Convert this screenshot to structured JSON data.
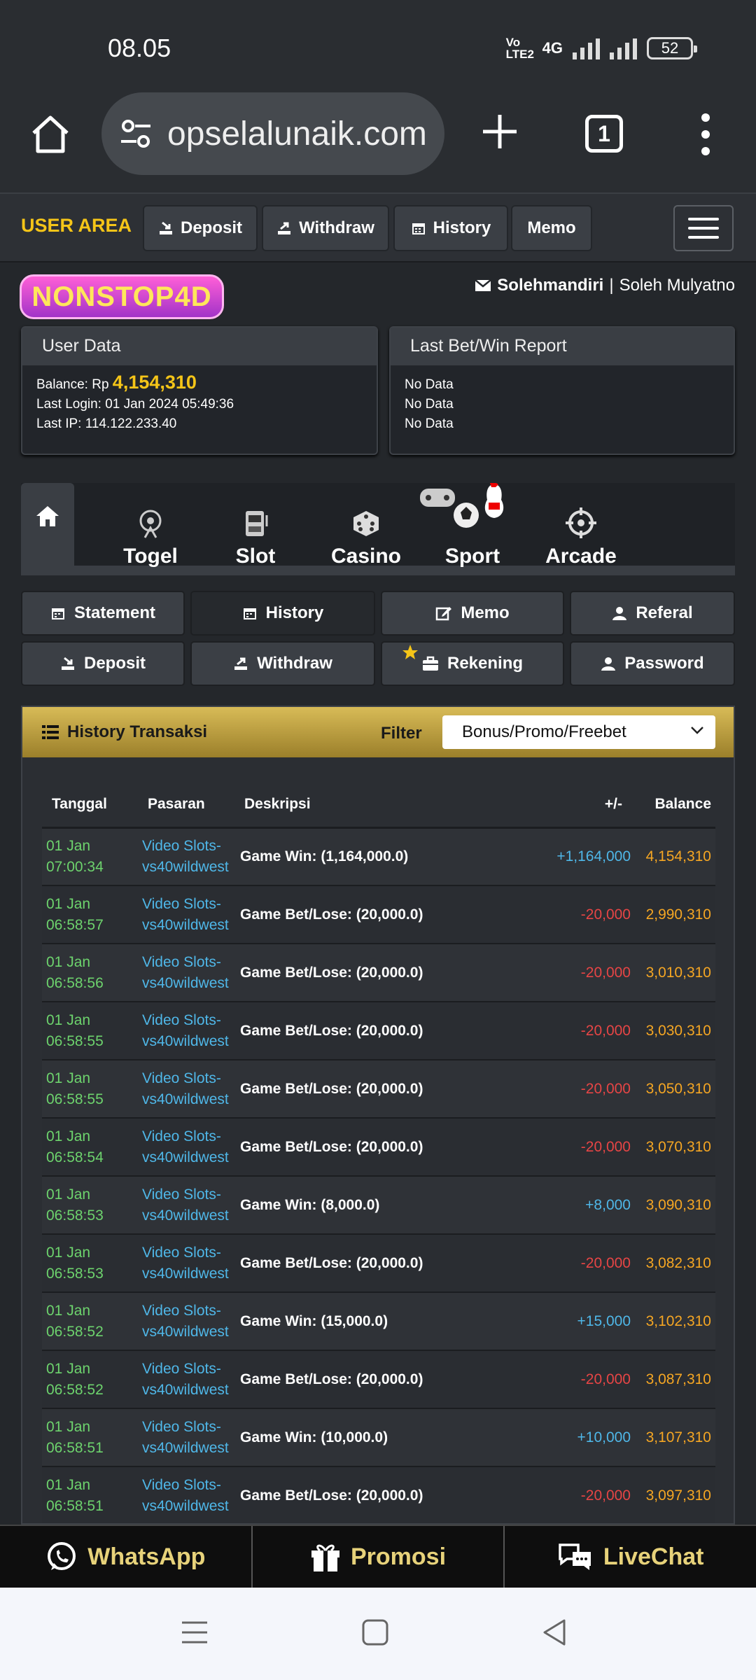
{
  "status": {
    "time": "08.05",
    "volte": "Vo LTE2",
    "net": "4G",
    "battery": "52"
  },
  "browser": {
    "url": "opselalunaik.com",
    "tab_count": "1"
  },
  "topnav": {
    "user_area": "USER AREA",
    "deposit": "Deposit",
    "withdraw": "Withdraw",
    "history": "History",
    "memo": "Memo"
  },
  "brand": {
    "logo_text": "NONSTOP4D"
  },
  "user": {
    "username": "Solehmandiri",
    "separator": "|",
    "fullname": "Soleh Mulyatno"
  },
  "user_data": {
    "title": "User Data",
    "balance_label": "Balance: Rp",
    "balance": "4,154,310",
    "last_login": "Last Login: 01 Jan 2024 05:49:36",
    "last_ip": "Last IP: 114.122.233.40"
  },
  "last_bet": {
    "title": "Last Bet/Win Report",
    "lines": [
      "No Data",
      "No Data",
      "No Data"
    ]
  },
  "categories": [
    "Togel",
    "Slot",
    "Casino",
    "Sport",
    "Arcade"
  ],
  "subnav": {
    "statement": "Statement",
    "history": "History",
    "memo": "Memo",
    "referal": "Referal",
    "deposit": "Deposit",
    "withdraw": "Withdraw",
    "rekening": "Rekening",
    "password": "Password"
  },
  "history": {
    "title": "History Transaksi",
    "filter_label": "Filter",
    "filter_value": "Bonus/Promo/Freebet",
    "columns": [
      "Tanggal",
      "Pasaran",
      "Deskripsi",
      "+/-",
      "Balance"
    ],
    "rows": [
      {
        "d1": "01 Jan",
        "d2": "07:00:34",
        "p1": "Video Slots-",
        "p2": "vs40wildwest",
        "desc": "Game Win: (1,164,000.0)",
        "amt": "+1,164,000",
        "bal": "4,154,310",
        "sign": "pos"
      },
      {
        "d1": "01 Jan",
        "d2": "06:58:57",
        "p1": "Video Slots-",
        "p2": "vs40wildwest",
        "desc": "Game Bet/Lose: (20,000.0)",
        "amt": "-20,000",
        "bal": "2,990,310",
        "sign": "neg"
      },
      {
        "d1": "01 Jan",
        "d2": "06:58:56",
        "p1": "Video Slots-",
        "p2": "vs40wildwest",
        "desc": "Game Bet/Lose: (20,000.0)",
        "amt": "-20,000",
        "bal": "3,010,310",
        "sign": "neg"
      },
      {
        "d1": "01 Jan",
        "d2": "06:58:55",
        "p1": "Video Slots-",
        "p2": "vs40wildwest",
        "desc": "Game Bet/Lose: (20,000.0)",
        "amt": "-20,000",
        "bal": "3,030,310",
        "sign": "neg"
      },
      {
        "d1": "01 Jan",
        "d2": "06:58:55",
        "p1": "Video Slots-",
        "p2": "vs40wildwest",
        "desc": "Game Bet/Lose: (20,000.0)",
        "amt": "-20,000",
        "bal": "3,050,310",
        "sign": "neg"
      },
      {
        "d1": "01 Jan",
        "d2": "06:58:54",
        "p1": "Video Slots-",
        "p2": "vs40wildwest",
        "desc": "Game Bet/Lose: (20,000.0)",
        "amt": "-20,000",
        "bal": "3,070,310",
        "sign": "neg"
      },
      {
        "d1": "01 Jan",
        "d2": "06:58:53",
        "p1": "Video Slots-",
        "p2": "vs40wildwest",
        "desc": "Game Win: (8,000.0)",
        "amt": "+8,000",
        "bal": "3,090,310",
        "sign": "pos"
      },
      {
        "d1": "01 Jan",
        "d2": "06:58:53",
        "p1": "Video Slots-",
        "p2": "vs40wildwest",
        "desc": "Game Bet/Lose: (20,000.0)",
        "amt": "-20,000",
        "bal": "3,082,310",
        "sign": "neg"
      },
      {
        "d1": "01 Jan",
        "d2": "06:58:52",
        "p1": "Video Slots-",
        "p2": "vs40wildwest",
        "desc": "Game Win: (15,000.0)",
        "amt": "+15,000",
        "bal": "3,102,310",
        "sign": "pos"
      },
      {
        "d1": "01 Jan",
        "d2": "06:58:52",
        "p1": "Video Slots-",
        "p2": "vs40wildwest",
        "desc": "Game Bet/Lose: (20,000.0)",
        "amt": "-20,000",
        "bal": "3,087,310",
        "sign": "neg"
      },
      {
        "d1": "01 Jan",
        "d2": "06:58:51",
        "p1": "Video Slots-",
        "p2": "vs40wildwest",
        "desc": "Game Win: (10,000.0)",
        "amt": "+10,000",
        "bal": "3,107,310",
        "sign": "pos"
      },
      {
        "d1": "01 Jan",
        "d2": "06:58:51",
        "p1": "Video Slots-",
        "p2": "vs40wildwest",
        "desc": "Game Bet/Lose: (20,000.0)",
        "amt": "-20,000",
        "bal": "3,097,310",
        "sign": "neg"
      }
    ]
  },
  "contact": {
    "whatsapp": "WhatsApp",
    "promosi": "Promosi",
    "livechat": "LiveChat"
  },
  "colors": {
    "gold": "#f5c518",
    "positive": "#4fb7e8",
    "negative": "#e64545",
    "balance": "#f5a623",
    "date": "#6dd36d"
  },
  "icons": [
    "home-icon",
    "tune-icon",
    "plus-icon",
    "tabs-icon",
    "more-icon",
    "deposit-icon",
    "withdraw-icon",
    "calendar-icon",
    "menu-icon",
    "mail-icon",
    "togel-icon",
    "slot-icon",
    "casino-icon",
    "sport-icon",
    "arcade-icon",
    "edit-icon",
    "user-icon",
    "briefcase-icon",
    "star-icon",
    "list-icon",
    "chevron-down-icon",
    "whatsapp-icon",
    "gift-icon",
    "chat-icon"
  ]
}
